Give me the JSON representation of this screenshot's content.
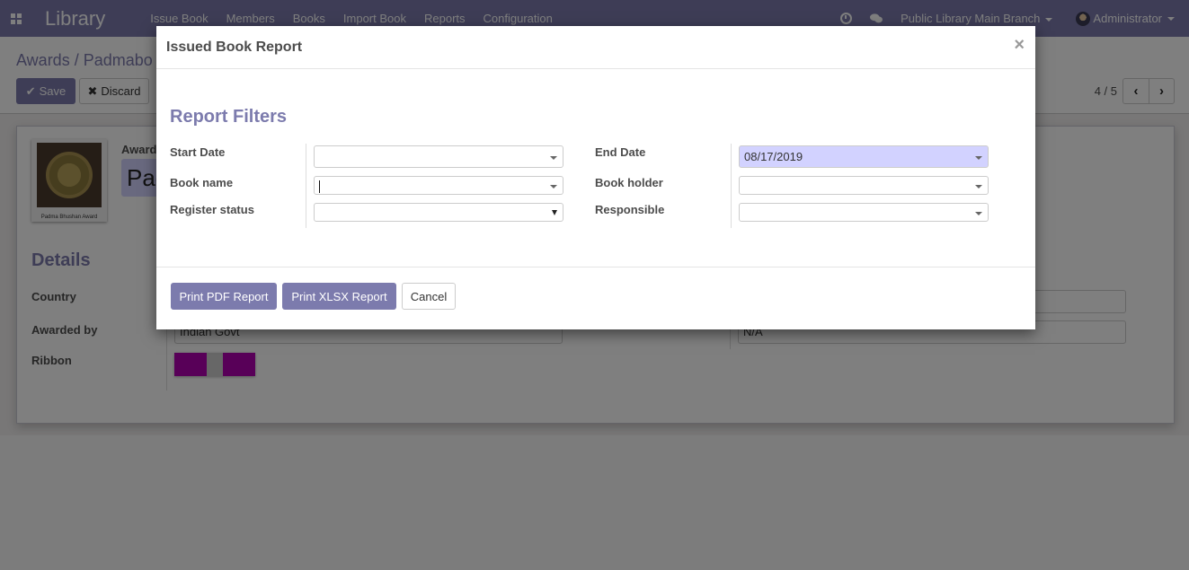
{
  "navbar": {
    "app_name": "Library",
    "menu": [
      "Issue Book",
      "Members",
      "Books",
      "Import Book",
      "Reports",
      "Configuration"
    ],
    "company": "Public Library Main Branch",
    "user": "Administrator"
  },
  "control_panel": {
    "breadcrumb": "Awards / Padmabo",
    "save_label": "Save",
    "discard_label": "Discard",
    "pager_value": "4 / 5"
  },
  "form": {
    "award_caption": "Padma Bhushan Award",
    "award_label": "Award",
    "award_name": "Pad",
    "details_title": "Details",
    "country_label": "Country",
    "awarded_by_label": "Awarded by",
    "awarded_by_value": "Indian Govt",
    "ribbon_label": "Ribbon",
    "right_field_value": "N/A",
    "ribbon_colors": {
      "outer": "#b000b0",
      "center": "#cfcfcf"
    }
  },
  "modal": {
    "title": "Issued Book Report",
    "close_symbol": "×",
    "section_title": "Report Filters",
    "left_fields": [
      {
        "label": "Start Date",
        "value": ""
      },
      {
        "label": "Book name",
        "value": ""
      },
      {
        "label": "Register status",
        "value": ""
      }
    ],
    "right_fields": [
      {
        "label": "End Date",
        "value": "08/17/2019"
      },
      {
        "label": "Book holder",
        "value": ""
      },
      {
        "label": "Responsible",
        "value": ""
      }
    ],
    "buttons": {
      "print_pdf": "Print PDF Report",
      "print_xlsx": "Print XLSX Report",
      "cancel": "Cancel"
    }
  },
  "colors": {
    "brand": "#7c7bad",
    "highlight_field": "#d2d2ff"
  }
}
